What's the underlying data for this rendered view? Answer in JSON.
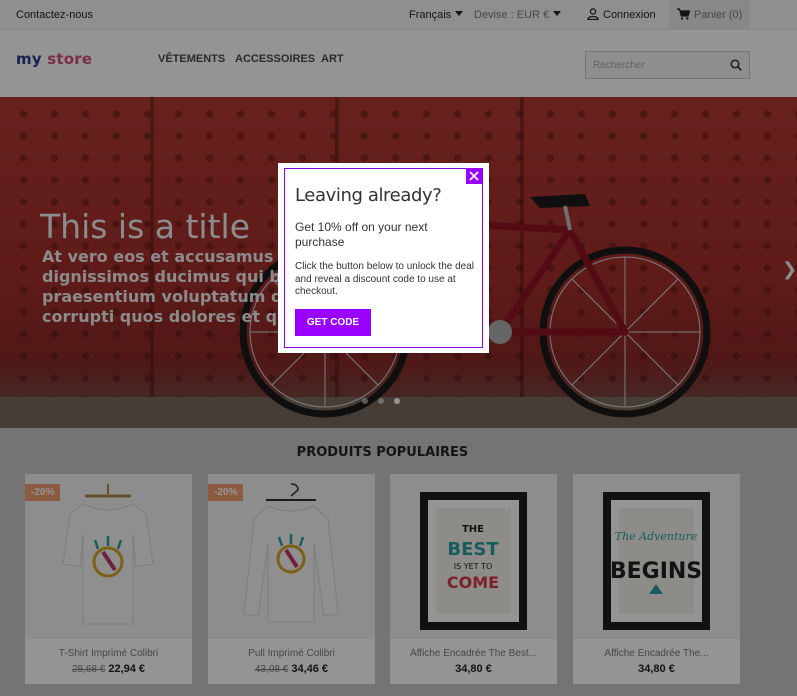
{
  "topbar": {
    "contact": "Contactez-nous",
    "language": "Français",
    "currency": "Devise : EUR €",
    "login": "Connexion",
    "cart": "Panier (0)"
  },
  "header": {
    "logo_part1": "my",
    "logo_part2": "store",
    "nav": [
      "VÊTEMENTS",
      "ACCESSOIRES",
      "ART"
    ],
    "search_placeholder": "Rechercher"
  },
  "hero": {
    "title": "This is a title",
    "text_lines": [
      "At vero eos et accusamus et iusto",
      "dignissimos ducimus qui blanditiis",
      "praesentium voluptatum deleniti",
      "corrupti quos dolores et quas"
    ],
    "slide_count": 3,
    "active_slide": 3
  },
  "products": {
    "section_title": "PRODUITS POPULAIRES",
    "items": [
      {
        "name": "T-Shirt Imprimé Colibri",
        "old_price": "28,68 €",
        "price": "22,94 €",
        "badge": "-20%"
      },
      {
        "name": "Pull Imprimé Colibri",
        "old_price": "43,08 €",
        "price": "34,46 €",
        "badge": "-20%"
      },
      {
        "name": "Affiche Encadrée The Best...",
        "old_price": "",
        "price": "34,80 €",
        "badge": ""
      },
      {
        "name": "Affiche Encadrée The...",
        "old_price": "",
        "price": "34,80 €",
        "badge": ""
      }
    ]
  },
  "modal": {
    "title": "Leaving already?",
    "offer": "Get 10% off on your next purchase",
    "description": "Click the button below to unlock the deal and reveal a discount code to use at checkout.",
    "cta": "GET CODE"
  },
  "colors": {
    "accent": "#9900ff",
    "badge": "#f39d72",
    "overlay": "rgba(0,0,0,0.42)"
  }
}
